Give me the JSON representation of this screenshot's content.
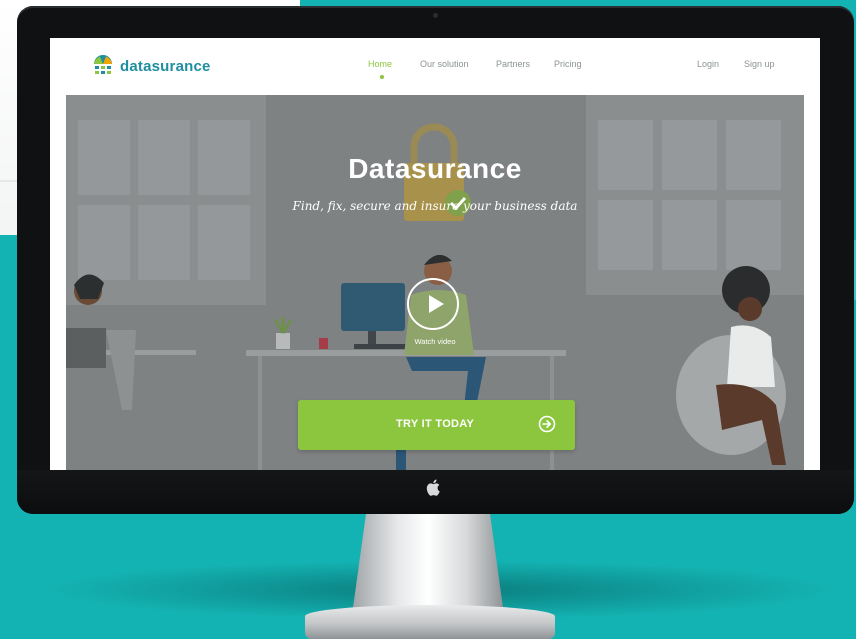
{
  "site": {
    "logo_text": "datasurance",
    "nav": [
      {
        "label": "Home",
        "active": true
      },
      {
        "label": "Our solution",
        "active": false
      },
      {
        "label": "Partners",
        "active": false
      },
      {
        "label": "Pricing",
        "active": false
      }
    ],
    "auth": {
      "login": "Login",
      "signup": "Sign up"
    }
  },
  "hero": {
    "title": "Datasurance",
    "subtitle": "Find, fix, secure and insure your business data",
    "watch_video": "Watch video",
    "cta_label": "TRY IT TODAY"
  },
  "icons": {
    "play": "play-icon",
    "arrow": "arrow-right-circle-icon",
    "apple": "apple-icon",
    "logo": "umbrella-logo-icon"
  },
  "colors": {
    "accent": "#8cc63f",
    "brand": "#1e8ea0",
    "backdrop": "#14b3b3"
  }
}
